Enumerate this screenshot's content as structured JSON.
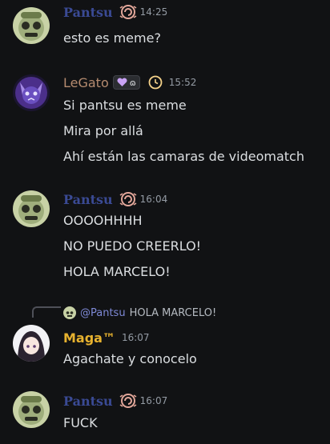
{
  "colors": {
    "background": "#111214",
    "pantsu_name": "#3a4a94",
    "legato_name": "#b58b6f",
    "maga_name": "#e7b22f",
    "message_text": "#dbdee1",
    "timestamp": "#949ba4",
    "mention": "#7e89d6"
  },
  "messages": [
    {
      "author": "Pantsu",
      "avatar": "green-skull-avatar",
      "badge": "swirl-icon",
      "time": "14:25",
      "lines": [
        "esto es meme?"
      ]
    },
    {
      "author": "LeGato",
      "avatar": "purple-cat-avatar",
      "tag_text": "ɷ",
      "tag_icons": [
        "purple-heart-icon"
      ],
      "badge": "clock-icon",
      "time": "15:52",
      "lines": [
        "Si pantsu es meme",
        "Mira por allá",
        "Ahí están las camaras de videomatch"
      ]
    },
    {
      "author": "Pantsu",
      "avatar": "green-skull-avatar",
      "badge": "swirl-icon",
      "time": "16:04",
      "lines": [
        "OOOOHHHH",
        "NO PUEDO CREERLO!",
        "HOLA MARCELO!"
      ]
    },
    {
      "reply": {
        "mention": "@Pantsu",
        "text": "HOLA MARCELO!"
      },
      "author": "Maga™",
      "avatar": "anime-girl-avatar",
      "time": "16:07",
      "lines": [
        "Agachate y conocelo"
      ]
    },
    {
      "author": "Pantsu",
      "avatar": "green-skull-avatar",
      "badge": "swirl-icon",
      "time": "16:07",
      "lines": [
        "FUCK"
      ]
    }
  ]
}
